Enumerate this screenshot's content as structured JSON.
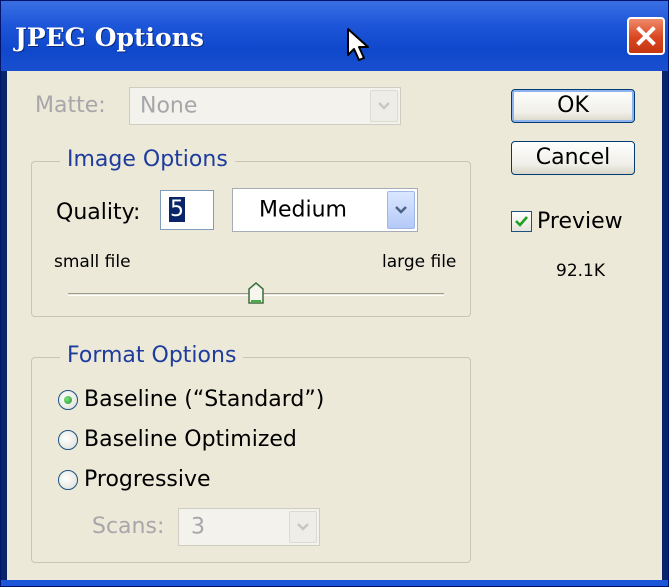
{
  "window": {
    "title": "JPEG Options"
  },
  "matte": {
    "label": "Matte:",
    "value": "None"
  },
  "image_options": {
    "legend": "Image Options",
    "quality_label": "Quality:",
    "quality_value": "5",
    "quality_preset": "Medium",
    "small_label": "small file",
    "large_label": "large file",
    "slider_fraction": 0.5
  },
  "format_options": {
    "legend": "Format Options",
    "options": [
      {
        "label": "Baseline (“Standard”)",
        "selected": true
      },
      {
        "label": "Baseline Optimized",
        "selected": false
      },
      {
        "label": "Progressive",
        "selected": false
      }
    ],
    "scans_label": "Scans:",
    "scans_value": "3"
  },
  "buttons": {
    "ok": "OK",
    "cancel": "Cancel"
  },
  "preview": {
    "label": "Preview",
    "checked": true,
    "size": "92.1K"
  },
  "colors": {
    "titlebar": "#1d55d8",
    "dialog": "#ece9d8",
    "close": "#d9461f",
    "legend": "#1e3c9e"
  },
  "icons": {
    "close": "close-x-icon",
    "cursor": "mouse-pointer-icon",
    "dropdown": "chevron-down-icon",
    "check": "checkmark-icon"
  }
}
